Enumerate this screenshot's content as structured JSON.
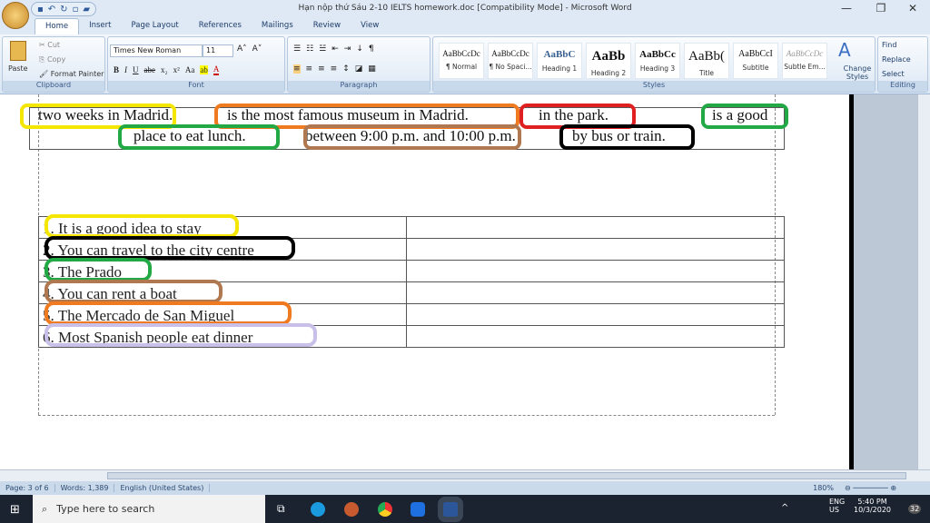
{
  "window": {
    "title": "Hạn nộp thứ Sáu 2-10 IELTS homework.doc [Compatibility Mode] - Microsoft Word",
    "minimize": "—",
    "restore": "❐",
    "close": "✕"
  },
  "tabs": [
    "Home",
    "Insert",
    "Page Layout",
    "References",
    "Mailings",
    "Review",
    "View"
  ],
  "clipboard": {
    "paste": "Paste",
    "cut": "Cut",
    "copy": "Copy",
    "format_painter": "Format Painter",
    "label": "Clipboard"
  },
  "font": {
    "name": "Times New Roman",
    "size": "11",
    "label": "Font",
    "buttons": [
      "B",
      "I",
      "U",
      "abe",
      "x₂",
      "x²",
      "Aa"
    ]
  },
  "paragraph": {
    "label": "Paragraph",
    "pilcrow": "¶"
  },
  "styles": {
    "label": "Styles",
    "items": [
      {
        "sample": "AaBbCcDc",
        "name": "¶ Normal"
      },
      {
        "sample": "AaBbCcDc",
        "name": "¶ No Spaci..."
      },
      {
        "sample": "AaBbC",
        "name": "Heading 1"
      },
      {
        "sample": "AaBb",
        "name": "Heading 2"
      },
      {
        "sample": "AaBbCc",
        "name": "Heading 3"
      },
      {
        "sample": "AaBb(",
        "name": "Title"
      },
      {
        "sample": "AaBbCcI",
        "name": "Subtitle"
      },
      {
        "sample": "AaBbCcDc",
        "name": "Subtle Em..."
      }
    ],
    "change_styles": "Change Styles"
  },
  "editing": {
    "label": "Editing",
    "find": "Find",
    "replace": "Replace",
    "select": "Select"
  },
  "document": {
    "answer_box": [
      {
        "text": "two weeks in Madrid.",
        "ring": "#f5e600"
      },
      {
        "text": "is the most famous museum in Madrid.",
        "ring": "#f07a20"
      },
      {
        "text": "in the park.",
        "ring": "#e02020"
      },
      {
        "text": "is a good",
        "ring": "#22a844"
      },
      {
        "text": "place to eat lunch.",
        "ring": "#22a844"
      },
      {
        "text": "between 9:00 p.m. and 10:00 p.m.",
        "ring": "#b07850"
      },
      {
        "text": "by bus or train.",
        "ring": "#000000"
      }
    ],
    "rows": [
      {
        "text": "1. It is a good idea to stay",
        "ring": "#f5e600"
      },
      {
        "text": "2. You can travel to the city centre",
        "ring": "#000000"
      },
      {
        "text": "3. The Prado",
        "ring": "#22a844"
      },
      {
        "text": "4. You can rent a boat",
        "ring": "#b07850"
      },
      {
        "text": "5. The Mercado de San Miguel",
        "ring": "#f07a20"
      },
      {
        "text": "6. Most Spanish people eat dinner",
        "ring": "#c8c0e8"
      }
    ]
  },
  "status": {
    "page": "Page: 3 of 6",
    "words": "Words: 1,389",
    "language": "English (United States)",
    "zoom": "180%"
  },
  "taskbar": {
    "search_placeholder": "Type here to search",
    "lang1": "ENG",
    "lang2": "US",
    "time": "5:40 PM",
    "date": "10/3/2020",
    "notifications": "32"
  }
}
